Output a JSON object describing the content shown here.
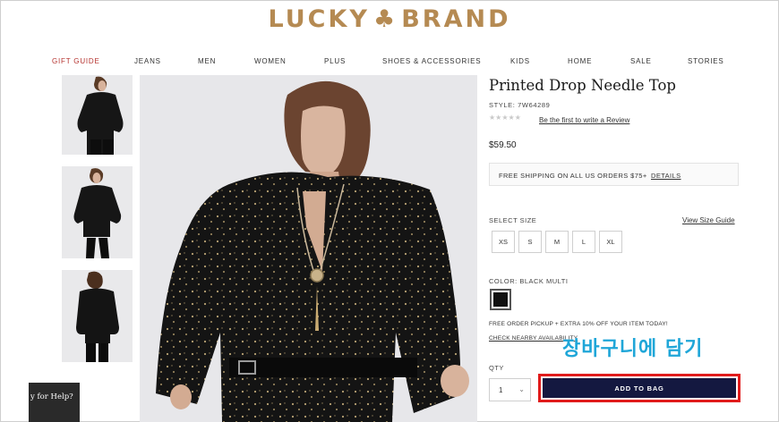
{
  "brand": {
    "left": "LUCKY",
    "right": "BRAND",
    "clover": "♣"
  },
  "nav": [
    "GIFT GUIDE",
    "JEANS",
    "MEN",
    "WOMEN",
    "PLUS",
    "SHOES & ACCESSORIES",
    "KIDS",
    "HOME",
    "SALE",
    "STORIES"
  ],
  "product": {
    "title": "Printed Drop Needle Top",
    "style": "STYLE: 7W64289",
    "stars": "★★★★★",
    "review_link": "Be the first to write a Review",
    "price": "$59.50",
    "shipping_text": "FREE SHIPPING ON ALL US ORDERS $75+",
    "shipping_link": "DETAILS"
  },
  "size": {
    "label": "SELECT SIZE",
    "guide": "View Size Guide",
    "options": [
      "XS",
      "S",
      "M",
      "L",
      "XL"
    ]
  },
  "color": {
    "label": "COLOR: BLACK MULTI",
    "swatch": "#111111"
  },
  "pickup": {
    "promo": "FREE ORDER PICKUP + EXTRA 10% OFF YOUR ITEM TODAY!",
    "availability": "CHECK NEARBY AVAILABILITY"
  },
  "annotation": "장바구니에 담기",
  "quantity": {
    "label": "QTY",
    "value": "1",
    "arrow": "⌄"
  },
  "add_to_bag": "ADD TO BAG",
  "help": {
    "text": "y for Help?"
  },
  "colors": {
    "brand": "#b58a52",
    "gift": "#b5322e",
    "button": "#141840",
    "highlight": "#e01b1b",
    "annotation": "#1fa6d8"
  }
}
